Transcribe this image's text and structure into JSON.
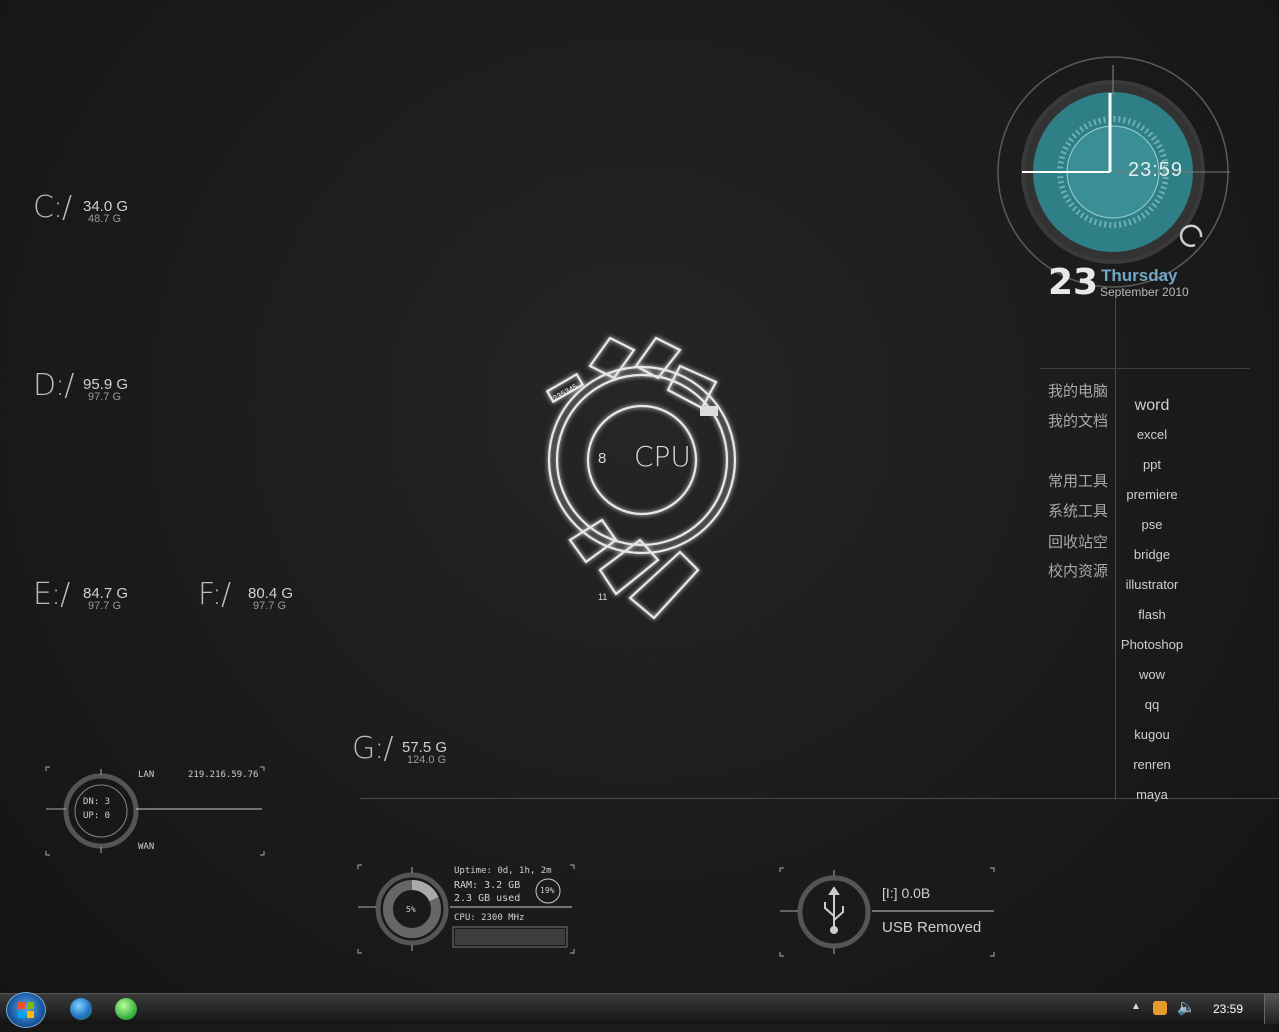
{
  "drives": [
    {
      "letter": "C:/",
      "free": "34.0 G",
      "total": "48.7 G"
    },
    {
      "letter": "D:/",
      "free": "95.9 G",
      "total": "97.7 G"
    },
    {
      "letter": "E:/",
      "free": "84.7 G",
      "total": "97.7 G"
    },
    {
      "letter": "F:/",
      "free": "80.4 G",
      "total": "97.7 G"
    },
    {
      "letter": "G:/",
      "free": "57.5 G",
      "total": "124.0 G"
    }
  ],
  "cpu_widget": {
    "label": "CPU",
    "cores": "8",
    "tick": "11",
    "arc_text": "235345"
  },
  "clock": {
    "time": "23:59",
    "day": "23",
    "weekday": "Thursday",
    "month_year": "September 2010"
  },
  "launcher": {
    "left_items": [
      "我的电脑",
      "我的文档",
      "常用工具",
      "系统工具",
      "回收站空",
      "校内资源"
    ],
    "right_items": [
      "word",
      "excel",
      "ppt",
      "premiere",
      "pse",
      "bridge",
      "illustrator",
      "flash",
      "Photoshop",
      "wow",
      "qq",
      "kugou",
      "renren",
      "maya"
    ]
  },
  "network": {
    "lan_label": "LAN",
    "wan_label": "WAN",
    "ip": "219.216.59.76",
    "down": "DN: 3",
    "up": "UP: 0"
  },
  "system": {
    "uptime": "Uptime:   0d, 1h, 2m",
    "ram": "RAM: 3.2 GB",
    "ram_used": "2.3 GB used",
    "ram_pct": "19%",
    "cpu": "CPU: 2300 MHz",
    "cpu_load": "5%"
  },
  "usb": {
    "drive": "[I:] 0.0B",
    "status": "USB Removed"
  },
  "taskbar": {
    "time": "23:59"
  },
  "colors": {
    "clock_teal": "#2f7f86",
    "accent_blue": "#6fa7c4"
  }
}
